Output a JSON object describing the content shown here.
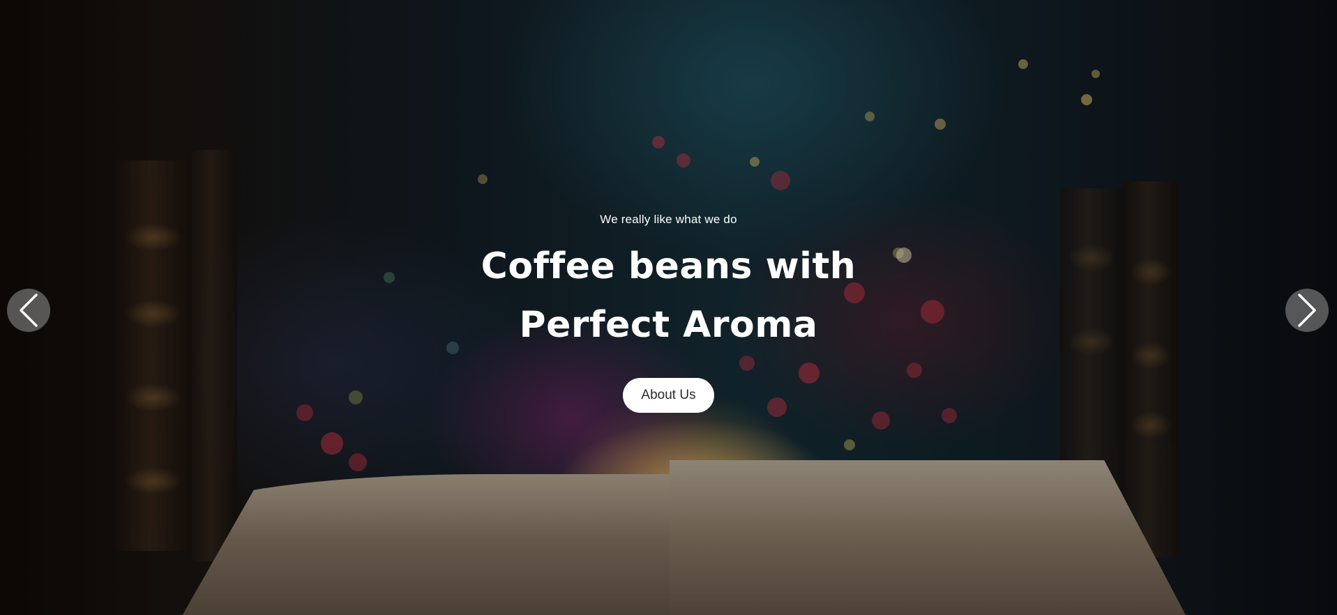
{
  "hero": {
    "kicker": "We really like what we do",
    "headline_line1": "Coffee beans with",
    "headline_line2": "Perfect Aroma",
    "cta_label": "About Us"
  },
  "carousel": {
    "prev_icon": "chevron-left-icon",
    "next_icon": "chevron-right-icon"
  },
  "colors": {
    "text": "#ffffff",
    "button_bg": "#ffffff",
    "button_text": "#2a2a2a",
    "arrow_bg": "rgba(150,150,150,0.55)"
  }
}
